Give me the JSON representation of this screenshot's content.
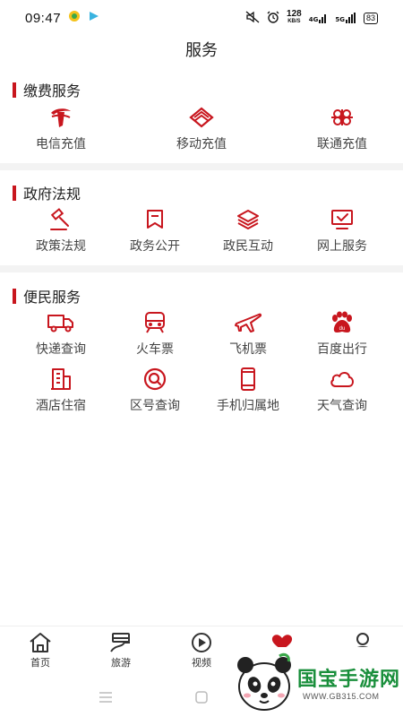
{
  "status_bar": {
    "time": "09:47",
    "speed_top": "128",
    "speed_unit": "KB/S",
    "signal1": "4G",
    "signal2": "5G",
    "battery": "83"
  },
  "page_title": "服务",
  "sections": {
    "payment": {
      "title": "缴费服务",
      "items": [
        {
          "label": "电信充值",
          "icon": "china-telecom-icon"
        },
        {
          "label": "移动充值",
          "icon": "china-mobile-icon"
        },
        {
          "label": "联通充值",
          "icon": "china-unicom-icon"
        }
      ]
    },
    "government": {
      "title": "政府法规",
      "items": [
        {
          "label": "政策法规",
          "icon": "gavel-icon"
        },
        {
          "label": "政务公开",
          "icon": "bookmark-icon"
        },
        {
          "label": "政民互动",
          "icon": "layers-icon"
        },
        {
          "label": "网上服务",
          "icon": "monitor-check-icon"
        }
      ]
    },
    "convenience": {
      "title": "便民服务",
      "items": [
        {
          "label": "快递查询",
          "icon": "truck-icon"
        },
        {
          "label": "火车票",
          "icon": "train-icon"
        },
        {
          "label": "飞机票",
          "icon": "airplane-icon"
        },
        {
          "label": "百度出行",
          "icon": "baidu-paw-icon"
        },
        {
          "label": "酒店住宿",
          "icon": "hotel-building-icon"
        },
        {
          "label": "区号查询",
          "icon": "search-circle-icon"
        },
        {
          "label": "手机归属地",
          "icon": "phone-icon"
        },
        {
          "label": "天气查询",
          "icon": "cloud-icon"
        }
      ]
    }
  },
  "bottom_nav": [
    {
      "label": "首页",
      "icon": "home-icon"
    },
    {
      "label": "旅游",
      "icon": "travel-icon"
    },
    {
      "label": "视频",
      "icon": "play-circle-icon"
    },
    {
      "label": "",
      "icon": "heart-icon"
    },
    {
      "label": "",
      "icon": "user-icon"
    }
  ],
  "watermark": {
    "text": "国宝手游网",
    "url": "WWW.GB315.COM"
  },
  "colors": {
    "accent": "#c8161e",
    "divider": "#f3f3f3"
  }
}
